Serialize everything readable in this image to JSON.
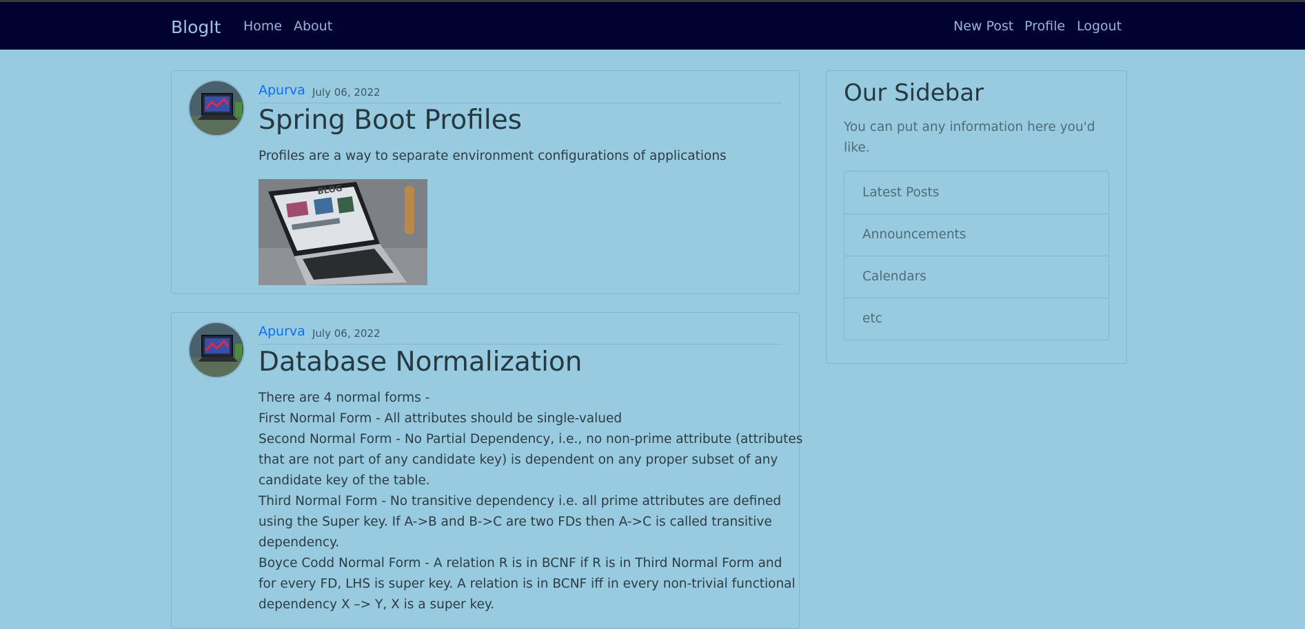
{
  "navbar": {
    "brand": "BlogIt",
    "left_links": [
      "Home",
      "About"
    ],
    "right_links": [
      "New Post",
      "Profile",
      "Logout"
    ]
  },
  "posts": [
    {
      "author": "Apurva",
      "date": "July 06, 2022",
      "title": "Spring Boot Profiles",
      "content_lines": [
        "Profiles are a way to separate environment configurations of applications"
      ],
      "has_image": true,
      "image_sign_text": "BLOG"
    },
    {
      "author": "Apurva",
      "date": "July 06, 2022",
      "title": "Database Normalization",
      "content_lines": [
        "There are 4 normal forms -",
        "First Normal Form - All attributes should be single-valued",
        "Second Normal Form - No Partial Dependency, i.e., no non-prime attribute (attributes",
        "that are not part of any candidate key) is dependent on any proper subset of any",
        "candidate key of the table.",
        "Third Normal Form - No transitive dependency i.e. all prime attributes are defined",
        "using the Super key. If A->B and B->C are two FDs then A->C is called transitive",
        "dependency.",
        "Boyce Codd Normal Form - A relation R is in BCNF if R is in Third Normal Form and",
        "for every FD, LHS is super key. A relation is in BCNF iff in every non-trivial functional",
        "dependency X –> Y, X is a super key."
      ],
      "has_image": false
    }
  ],
  "sidebar": {
    "title": "Our Sidebar",
    "text": "You can put any information here you'd like.",
    "items": [
      "Latest Posts",
      "Announcements",
      "Calendars",
      "etc"
    ]
  },
  "colors": {
    "page_background": "#98cbe0",
    "navbar_background": "#020230",
    "author_link": "#0d6efd"
  }
}
